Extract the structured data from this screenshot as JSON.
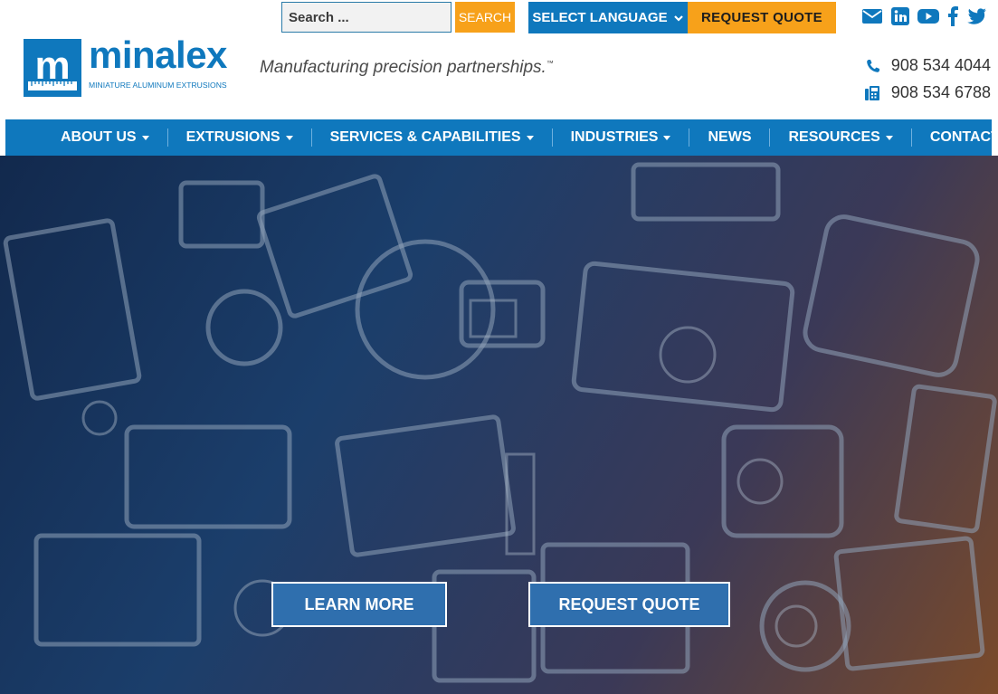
{
  "header": {
    "search": {
      "placeholder": "Search ...",
      "button_label": "SEARCH"
    },
    "language_select": {
      "label": "SELECT LANGUAGE"
    },
    "request_quote_label": "REQUEST QUOTE",
    "social_icons": [
      "envelope-icon",
      "linkedin-icon",
      "youtube-icon",
      "facebook-icon",
      "twitter-icon"
    ],
    "logo": {
      "mark": "m",
      "word": "minalex",
      "subtitle": "MINIATURE ALUMINUM EXTRUSIONS"
    },
    "tagline": "Manufacturing precision partnerships.",
    "tagline_mark": "™",
    "phone": "908 534 4044",
    "fax": "908 534 6788"
  },
  "nav": {
    "items": [
      {
        "label": "ABOUT US",
        "dropdown": true
      },
      {
        "label": "EXTRUSIONS",
        "dropdown": true
      },
      {
        "label": "SERVICES & CAPABILITIES",
        "dropdown": true
      },
      {
        "label": "INDUSTRIES",
        "dropdown": true
      },
      {
        "label": "NEWS",
        "dropdown": false
      },
      {
        "label": "RESOURCES",
        "dropdown": true
      },
      {
        "label": "CONTACT",
        "dropdown": true
      }
    ]
  },
  "hero": {
    "learn_more_label": "LEARN MORE",
    "request_quote_label": "REQUEST QUOTE"
  },
  "colors": {
    "brand_blue": "#0f78bd",
    "accent_orange": "#f7a11a",
    "hero_button": "#2f6fae"
  }
}
